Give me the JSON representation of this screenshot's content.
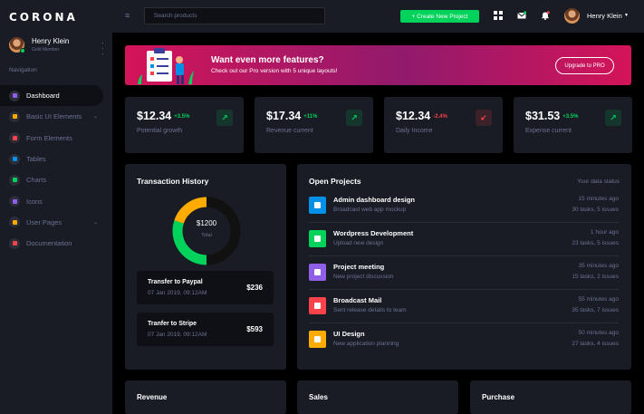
{
  "sidebar": {
    "brand": "CORONA",
    "profile": {
      "name": "Henry Klein",
      "role": "Gold Member"
    },
    "nav_caption": "Navigation",
    "items": [
      {
        "label": "Dashboard",
        "icon": "speedometer-icon",
        "color": "#8f5fe8"
      },
      {
        "label": "Basic UI Elements",
        "icon": "laptop-icon",
        "color": "#ffab00"
      },
      {
        "label": "Form Elements",
        "icon": "playlist-icon",
        "color": "#fc424a"
      },
      {
        "label": "Tables",
        "icon": "table-icon",
        "color": "#0090e7"
      },
      {
        "label": "Charts",
        "icon": "chart-bar-icon",
        "color": "#00d25b"
      },
      {
        "label": "Icons",
        "icon": "contacts-icon",
        "color": "#8f5fe8"
      },
      {
        "label": "User Pages",
        "icon": "security-icon",
        "color": "#ffab00"
      },
      {
        "label": "Documentation",
        "icon": "file-document-icon",
        "color": "#fc424a"
      }
    ]
  },
  "topbar": {
    "search_placeholder": "Search products",
    "create_label": "+ Create New Project",
    "user_name": "Henry Klein"
  },
  "banner": {
    "title": "Want even more features?",
    "text": "Check out our Pro version with 5 unique layouts!",
    "button": "Upgrade to PRO"
  },
  "stats": [
    {
      "value": "$12.34",
      "change": "+3.5%",
      "label": "Potential growth",
      "trend": "up",
      "change_color": "#00d25b"
    },
    {
      "value": "$17.34",
      "change": "+11%",
      "label": "Revenue current",
      "trend": "up",
      "change_color": "#00d25b"
    },
    {
      "value": "$12.34",
      "change": "-2.4%",
      "label": "Daily Income",
      "trend": "down",
      "change_color": "#fc424a"
    },
    {
      "value": "$31.53",
      "change": "+3.5%",
      "label": "Expense current",
      "trend": "up",
      "change_color": "#00d25b"
    }
  ],
  "transaction_history": {
    "title": "Transaction History",
    "total_amount": "$1200",
    "total_caption": "Total",
    "transactions": [
      {
        "title": "Transfer to Paypal",
        "date": "07 Jan 2019, 09:12AM",
        "amount": "$236"
      },
      {
        "title": "Tranfer to Stripe",
        "date": "07 Jan 2019, 09:12AM",
        "amount": "$593"
      }
    ]
  },
  "open_projects": {
    "title": "Open Projects",
    "status_label": "Your data status",
    "projects": [
      {
        "title": "Admin dashboard design",
        "subtitle": "Broadcast web app mockup",
        "time": "15 minutes ago",
        "stats": "30 tasks, 5 issues",
        "icon": "file-icon",
        "color": "#0090e7"
      },
      {
        "title": "Wordpress Development",
        "subtitle": "Upload new design",
        "time": "1 hour ago",
        "stats": "23 tasks, 5 issues",
        "icon": "cloud-download-icon",
        "color": "#00d25b"
      },
      {
        "title": "Project meeting",
        "subtitle": "New project discussion",
        "time": "35 minutes ago",
        "stats": "15 tasks, 2 issues",
        "icon": "clock-icon",
        "color": "#8f5fe8"
      },
      {
        "title": "Broadcast Mail",
        "subtitle": "Sent release details to team",
        "time": "55 minutes ago",
        "stats": "35 tasks, 7 issues",
        "icon": "email-icon",
        "color": "#fc424a"
      },
      {
        "title": "UI Design",
        "subtitle": "New application planning",
        "time": "50 minutes ago",
        "stats": "27 tasks, 4 issues",
        "icon": "chart-pie-icon",
        "color": "#ffab00"
      }
    ]
  },
  "bottom_cards": [
    "Revenue",
    "Sales",
    "Purchase"
  ]
}
